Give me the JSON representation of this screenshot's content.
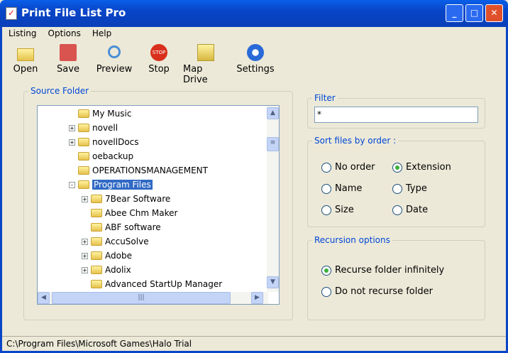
{
  "window": {
    "title": "Print File List Pro",
    "minimize": "_",
    "maximize": "□",
    "close": "✕"
  },
  "menu": [
    "Listing",
    "Options",
    "Help"
  ],
  "toolbar": [
    {
      "label": "Open",
      "icon": "folder-open-icon"
    },
    {
      "label": "Save",
      "icon": "floppy-icon"
    },
    {
      "label": "Preview",
      "icon": "magnifier-icon"
    },
    {
      "label": "Stop",
      "icon": "stop-icon"
    },
    {
      "label": "Map Drive",
      "icon": "network-folder-icon"
    },
    {
      "label": "Settings",
      "icon": "gear-icon"
    }
  ],
  "source": {
    "legend": "Source Folder",
    "tree": [
      {
        "label": "My Music",
        "level": 0,
        "expander": ""
      },
      {
        "label": "novell",
        "level": 0,
        "expander": "+"
      },
      {
        "label": "novellDocs",
        "level": 0,
        "expander": "+"
      },
      {
        "label": "oebackup",
        "level": 0,
        "expander": ""
      },
      {
        "label": "OPERATIONSMANAGEMENT",
        "level": 0,
        "expander": ""
      },
      {
        "label": "Program Files",
        "level": 0,
        "expander": "-",
        "selected": true
      },
      {
        "label": "7Bear Software",
        "level": 1,
        "expander": "+"
      },
      {
        "label": "Abee Chm Maker",
        "level": 1,
        "expander": ""
      },
      {
        "label": "ABF software",
        "level": 1,
        "expander": ""
      },
      {
        "label": "AccuSolve",
        "level": 1,
        "expander": "+"
      },
      {
        "label": "Adobe",
        "level": 1,
        "expander": "+"
      },
      {
        "label": "Adolix",
        "level": 1,
        "expander": "+"
      },
      {
        "label": "Advanced StartUp Manager",
        "level": 1,
        "expander": ""
      }
    ]
  },
  "filter": {
    "legend": "Filter",
    "value": "*"
  },
  "sort": {
    "legend": "Sort files by order :",
    "options": [
      {
        "label": "No order",
        "checked": false
      },
      {
        "label": "Extension",
        "checked": true
      },
      {
        "label": "Name",
        "checked": false
      },
      {
        "label": "Type",
        "checked": false
      },
      {
        "label": "Size",
        "checked": false
      },
      {
        "label": "Date",
        "checked": false
      }
    ]
  },
  "recursion": {
    "legend": "Recursion options",
    "options": [
      {
        "label": "Recurse folder infinitely",
        "checked": true
      },
      {
        "label": "Do not recurse folder",
        "checked": false
      }
    ]
  },
  "status": "C:\\Program Files\\Microsoft Games\\Halo Trial"
}
